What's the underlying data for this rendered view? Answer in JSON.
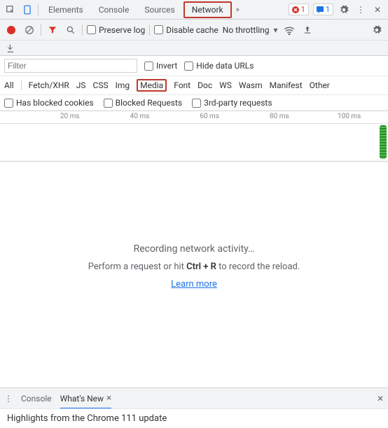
{
  "tabs": {
    "elements": "Elements",
    "console": "Console",
    "sources": "Sources",
    "network": "Network"
  },
  "badges": {
    "errors": "1",
    "messages": "1"
  },
  "toolbar": {
    "preserve_log": "Preserve log",
    "disable_cache": "Disable cache",
    "throttling": "No throttling"
  },
  "filter": {
    "placeholder": "Filter",
    "invert": "Invert",
    "hide_data_urls": "Hide data URLs"
  },
  "types": {
    "all": "All",
    "fetch": "Fetch/XHR",
    "js": "JS",
    "css": "CSS",
    "img": "Img",
    "media": "Media",
    "font": "Font",
    "doc": "Doc",
    "ws": "WS",
    "wasm": "Wasm",
    "manifest": "Manifest",
    "other": "Other"
  },
  "options": {
    "blocked_cookies": "Has blocked cookies",
    "blocked_requests": "Blocked Requests",
    "third_party": "3rd-party requests"
  },
  "ruler": {
    "t1": "20 ms",
    "t2": "40 ms",
    "t3": "60 ms",
    "t4": "80 ms",
    "t5": "100 ms"
  },
  "main": {
    "recording": "Recording network activity…",
    "hint_pre": "Perform a request or hit ",
    "hint_key": "Ctrl + R",
    "hint_post": " to record the reload.",
    "learn_more": "Learn more"
  },
  "bottom": {
    "console": "Console",
    "whatsnew": "What's New"
  },
  "footer": {
    "text": "Highlights from the Chrome 111 update"
  }
}
